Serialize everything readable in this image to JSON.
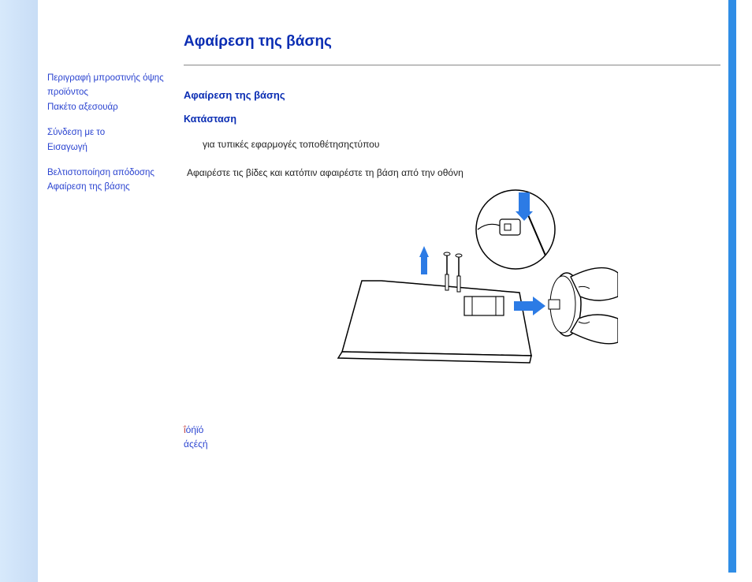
{
  "sidebar": {
    "block1": {
      "line1": "Περιγραφή μπροστινής όψης",
      "line2": "προϊόντος",
      "line3": "Πακέτο αξεσουάρ"
    },
    "block2": {
      "line1": "Σύνδεση με το",
      "line2": "Εισαγωγή"
    },
    "block3": {
      "line1": "Βελτιστοποίηση απόδοσης",
      "line2": "Αφαίρεση της βάσης"
    }
  },
  "content": {
    "title": "Αφαίρεση της βάσης",
    "subheading": "Αφαίρεση της βάσης",
    "condition_label": "Κατάσταση",
    "bullet1": "για τυπικές εφαρμογές τοποθέτησηςτύπου",
    "instruction": "Αφαιρέστε τις    βίδες και  κατόπιν  αφαιρέστε τη βάση από την οθόνη"
  },
  "footer": {
    "frag1a": "ΐ",
    "frag1b": "όήϊό",
    "frag2": "άςέςή"
  }
}
